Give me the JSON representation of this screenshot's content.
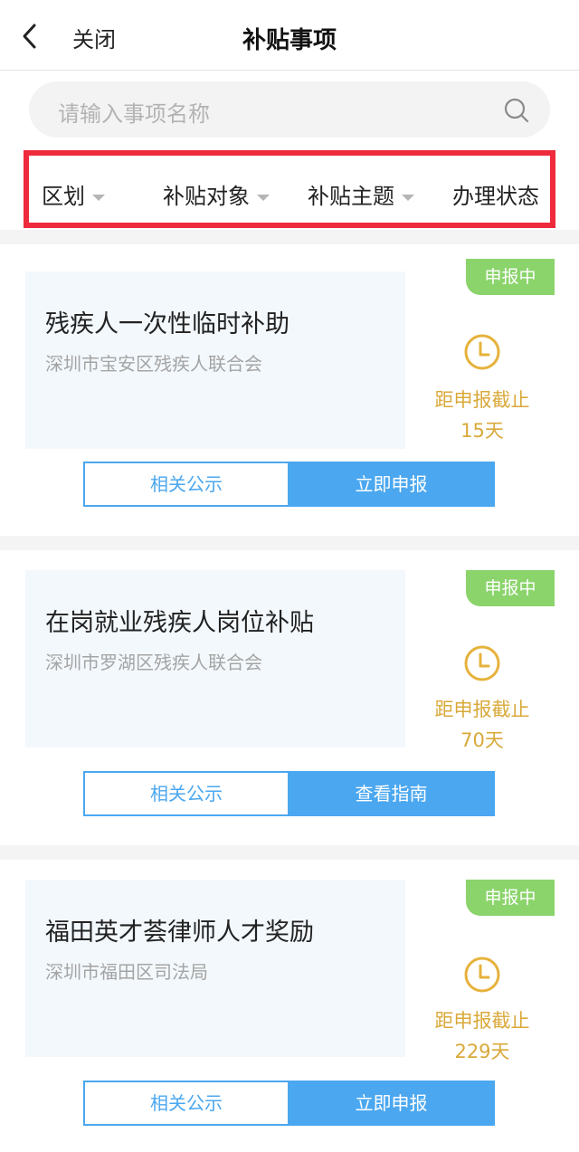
{
  "nav": {
    "close_label": "关闭",
    "title": "补贴事项"
  },
  "search": {
    "placeholder": "请输入事项名称"
  },
  "filters": [
    "区划",
    "补贴对象",
    "补贴主题",
    "办理状态"
  ],
  "cards": [
    {
      "badge": "申报中",
      "name": "残疾人一次性临时补助",
      "org": "深圳市宝安区残疾人联合会",
      "deadline_label": "距申报截止",
      "days": "15天",
      "btn_left": "相关公示",
      "btn_right": "立即申报"
    },
    {
      "badge": "申报中",
      "name": "在岗就业残疾人岗位补贴",
      "org": "深圳市罗湖区残疾人联合会",
      "deadline_label": "距申报截止",
      "days": "70天",
      "btn_left": "相关公示",
      "btn_right": "查看指南"
    },
    {
      "badge": "申报中",
      "name": "福田英才荟律师人才奖励",
      "org": "深圳市福田区司法局",
      "deadline_label": "距申报截止",
      "days": "229天",
      "btn_left": "相关公示",
      "btn_right": "立即申报"
    }
  ],
  "colors": {
    "accent": "#4ba7ef",
    "badge": "#8bd46c",
    "deadline": "#d9a93a",
    "highlight_border": "#ee2a3c"
  }
}
